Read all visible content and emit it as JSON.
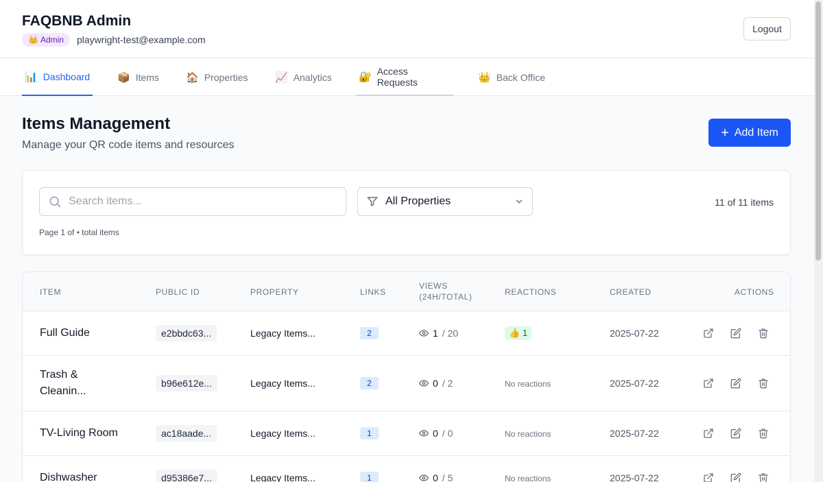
{
  "header": {
    "app_title": "FAQBNB Admin",
    "role_badge": "Admin",
    "role_icon": "crown-icon",
    "user_email": "playwright-test@example.com",
    "logout_label": "Logout"
  },
  "nav": {
    "tabs": [
      {
        "label": "Dashboard",
        "emoji": "📊",
        "state": "active"
      },
      {
        "label": "Items",
        "emoji": "📦"
      },
      {
        "label": "Properties",
        "emoji": "🏠"
      },
      {
        "label": "Analytics",
        "emoji": "📈"
      },
      {
        "label": "Access Requests",
        "emoji": "🔐",
        "state": "hover"
      },
      {
        "label": "Back Office",
        "emoji": "👑"
      }
    ]
  },
  "page": {
    "title": "Items Management",
    "subtitle": "Manage your QR code items and resources",
    "add_button_label": "Add Item"
  },
  "filters": {
    "search_placeholder": "Search items...",
    "search_value": "",
    "property_select_value": "All Properties",
    "count_text": "11 of 11 items",
    "page_info": "Page 1 of • total items"
  },
  "table": {
    "columns": [
      "Item",
      "Public ID",
      "Property",
      "Links",
      "Views (24h/Total)",
      "Reactions",
      "Created",
      "Actions"
    ],
    "rows": [
      {
        "name": "Full Guide",
        "public_id": "e2bbdc63...",
        "property": "Legacy Items...",
        "links": "2",
        "views_24h": "1",
        "views_total": "/ 20",
        "reactions": "👍 1",
        "created": "2025-07-22"
      },
      {
        "name": "Trash & Cleanin...",
        "public_id": "b96e612e...",
        "property": "Legacy Items...",
        "links": "2",
        "views_24h": "0",
        "views_total": "/ 2",
        "reactions": "No reactions",
        "created": "2025-07-22"
      },
      {
        "name": "TV-Living Room",
        "public_id": "ac18aade...",
        "property": "Legacy Items...",
        "links": "1",
        "views_24h": "0",
        "views_total": "/ 0",
        "reactions": "No reactions",
        "created": "2025-07-22"
      },
      {
        "name": "Dishwasher",
        "public_id": "d95386e7...",
        "property": "Legacy Items...",
        "links": "1",
        "views_24h": "0",
        "views_total": "/ 5",
        "reactions": "No reactions",
        "created": "2025-07-22"
      }
    ]
  },
  "colors": {
    "primary": "#1a56f5",
    "active_tab": "#2563eb",
    "admin_badge_bg": "#f3e8ff",
    "links_badge_bg": "#dbeafe",
    "reaction_bg": "#dcfce7"
  }
}
